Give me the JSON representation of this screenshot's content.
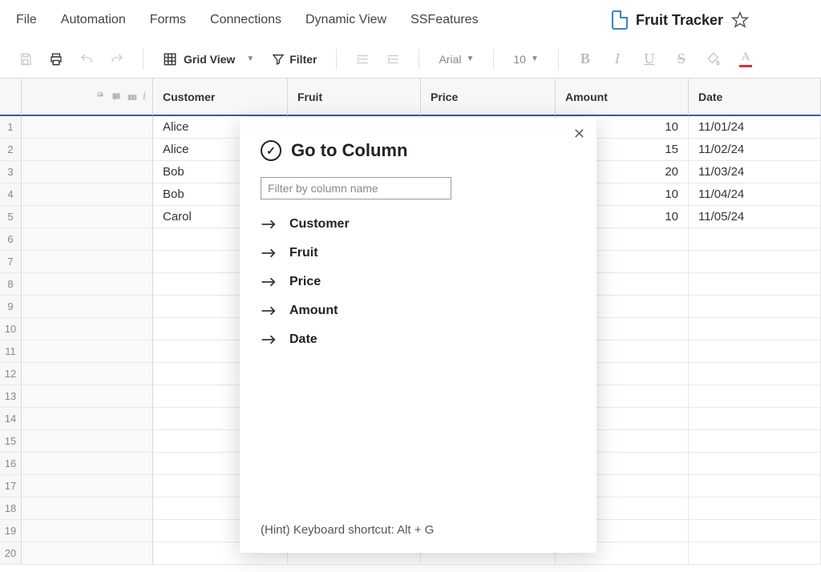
{
  "menu": {
    "file": "File",
    "automation": "Automation",
    "forms": "Forms",
    "connections": "Connections",
    "dynamic_view": "Dynamic View",
    "ssfeatures": "SSFeatures"
  },
  "title": "Fruit Tracker",
  "toolbar": {
    "view": "Grid View",
    "filter": "Filter",
    "font": "Arial",
    "size": "10"
  },
  "columns": [
    "Customer",
    "Fruit",
    "Price",
    "Amount",
    "Date"
  ],
  "rows": [
    {
      "n": "1",
      "customer": "Alice",
      "amount": "10",
      "date": "11/01/24"
    },
    {
      "n": "2",
      "customer": "Alice",
      "amount": "15",
      "date": "11/02/24"
    },
    {
      "n": "3",
      "customer": "Bob",
      "amount": "20",
      "date": "11/03/24"
    },
    {
      "n": "4",
      "customer": "Bob",
      "amount": "10",
      "date": "11/04/24"
    },
    {
      "n": "5",
      "customer": "Carol",
      "amount": "10",
      "date": "11/05/24"
    }
  ],
  "empty_rows": [
    "6",
    "7",
    "8",
    "9",
    "10",
    "11",
    "12",
    "13",
    "14",
    "15",
    "16",
    "17",
    "18",
    "19",
    "20"
  ],
  "modal": {
    "title": "Go to Column",
    "placeholder": "Filter by column name",
    "items": [
      "Customer",
      "Fruit",
      "Price",
      "Amount",
      "Date"
    ],
    "hint": "(Hint) Keyboard shortcut: Alt + G"
  }
}
